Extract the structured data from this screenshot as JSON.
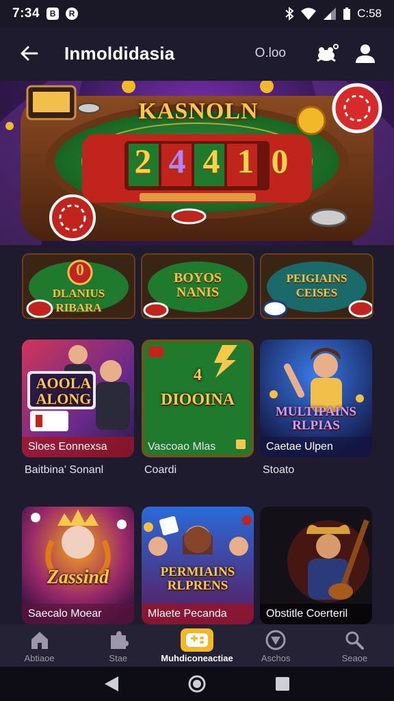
{
  "status_bar": {
    "time": "7:34",
    "notif_icon_1": "B",
    "notif_icon_2": "R",
    "battery_text": "C:58"
  },
  "app_bar": {
    "title": "Inmoldidasia",
    "balance": "O.loo",
    "icons": [
      "back-arrow-icon",
      "frog-icon",
      "profile-icon"
    ]
  },
  "banner": {
    "title": "KASNOLN",
    "digits": [
      "2",
      "4",
      "4",
      "1",
      "0"
    ]
  },
  "promos": [
    {
      "text": "DLANIUS RIBARA",
      "badge": "0"
    },
    {
      "text": "BOYOS NANIS"
    },
    {
      "text": "PEIGIAINS CEISES"
    }
  ],
  "games": [
    {
      "headline": "AOOLA ALONG",
      "footer": "Sloes Eonnexsa",
      "label": "Baitbina' Sonanl"
    },
    {
      "headline": "4 DIOOINA",
      "footer": "Vascoao Mlas",
      "label": "Coardi"
    },
    {
      "headline": "MULTIPAINS RLPIAS",
      "footer": "Caetae Ulpen",
      "label": "Stoato"
    },
    {
      "headline": "Zassind",
      "footer": "Saecalo Moear",
      "label": ""
    },
    {
      "headline": "PERMIAINS RLPRENS",
      "footer": "Mlaete Pecanda",
      "label": ""
    },
    {
      "headline": "",
      "footer": "Obstitle Coerteril",
      "label": ""
    }
  ],
  "bottom_nav": [
    {
      "label": "Abtiaoe",
      "icon": "home-icon"
    },
    {
      "label": "Stae",
      "icon": "puzzle-icon"
    },
    {
      "label": "Muhdiconeactiae",
      "icon": "gamepad-icon",
      "active": true
    },
    {
      "label": "Aschos",
      "icon": "shield-icon"
    },
    {
      "label": "Seaoe",
      "icon": "search-icon"
    }
  ],
  "colors": {
    "background": "#1f1b2e",
    "accent": "#f4b826",
    "felt_green": "#1f7a2e",
    "felt_red": "#c0241c"
  }
}
